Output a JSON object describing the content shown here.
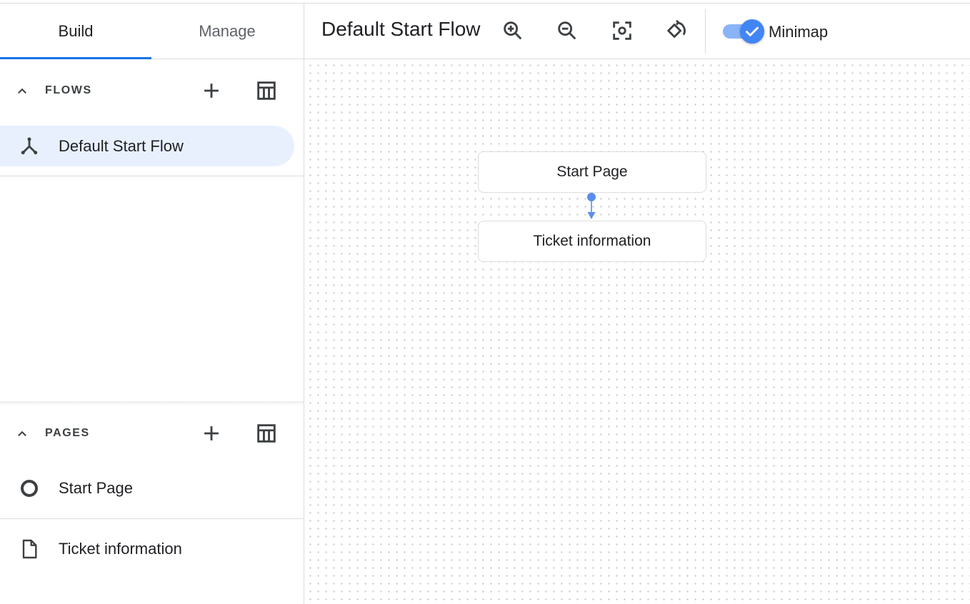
{
  "tabs": [
    {
      "label": "Build",
      "active": true
    },
    {
      "label": "Manage",
      "active": false
    }
  ],
  "flows": {
    "title": "FLOWS",
    "items": [
      {
        "label": "Default Start Flow",
        "icon": "flow-icon",
        "selected": true
      }
    ]
  },
  "pages": {
    "title": "PAGES",
    "items": [
      {
        "label": "Start Page",
        "icon": "start-page-icon"
      },
      {
        "label": "Ticket information",
        "icon": "page-icon"
      }
    ]
  },
  "toolbar": {
    "title": "Default Start Flow",
    "tools": [
      "zoom-in-icon",
      "zoom-out-icon",
      "center-focus-icon",
      "rotate-icon"
    ],
    "minimap_label": "Minimap",
    "minimap_enabled": true
  },
  "canvas": {
    "nodes": [
      {
        "label": "Start Page"
      },
      {
        "label": "Ticket information"
      }
    ]
  },
  "colors": {
    "accent": "#1a73e8",
    "selected_bg": "#e8f0fe",
    "toggle_track": "#8ab4f8",
    "toggle_knob": "#4285f4",
    "connector": "#5b8def"
  }
}
